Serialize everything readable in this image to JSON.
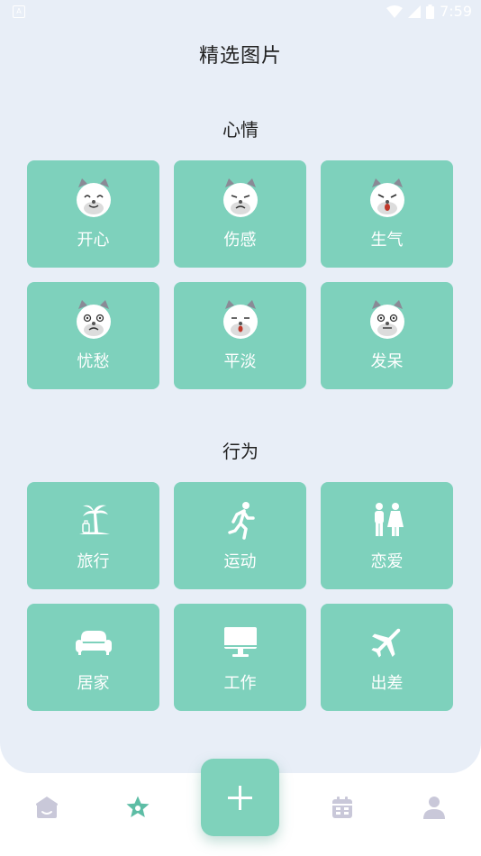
{
  "status": {
    "time": "7:59"
  },
  "title": "精选图片",
  "sections": {
    "mood": {
      "title": "心情",
      "items": [
        "开心",
        "伤感",
        "生气",
        "忧愁",
        "平淡",
        "发呆"
      ]
    },
    "behavior": {
      "title": "行为",
      "items": [
        "旅行",
        "运动",
        "恋爱",
        "居家",
        "工作",
        "出差"
      ]
    }
  },
  "colors": {
    "tile": "#7ed1bc",
    "panel": "#e8eef7",
    "nav_active": "#5dbda5",
    "nav_inactive": "#c9c8d9"
  },
  "nav": {
    "items": [
      "home-icon",
      "star-icon",
      "add-icon",
      "calendar-icon",
      "user-icon"
    ],
    "active": "star-icon"
  }
}
